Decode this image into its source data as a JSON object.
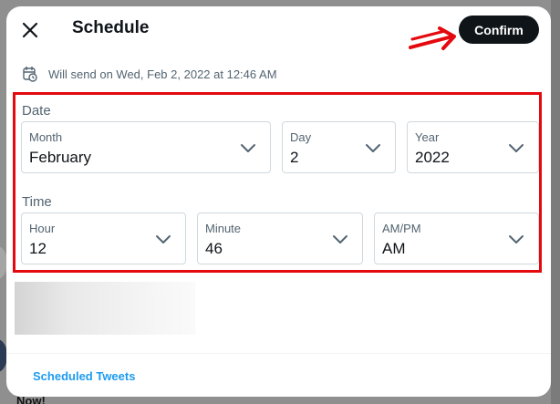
{
  "modal": {
    "title": "Schedule",
    "confirm_label": "Confirm",
    "will_send_text": "Will send on Wed, Feb 2, 2022 at 12:46 AM",
    "scheduled_tweets_label": "Scheduled Tweets"
  },
  "date": {
    "section_label": "Date",
    "month": {
      "label": "Month",
      "value": "February"
    },
    "day": {
      "label": "Day",
      "value": "2"
    },
    "year": {
      "label": "Year",
      "value": "2022"
    }
  },
  "time": {
    "section_label": "Time",
    "hour": {
      "label": "Hour",
      "value": "12"
    },
    "minute": {
      "label": "Minute",
      "value": "46"
    },
    "ampm": {
      "label": "AM/PM",
      "value": "AM"
    }
  },
  "background": {
    "bottom_text": "Now!"
  },
  "colors": {
    "confirm_bg": "#0f1419",
    "link": "#1d9bf0",
    "annotation_red": "#e4090f",
    "secondary_text": "#536471"
  },
  "icons": {
    "close": "close-icon",
    "calendar": "calendar-clock-icon",
    "chevron": "chevron-down-icon",
    "arrow": "arrow-right-annotation"
  }
}
